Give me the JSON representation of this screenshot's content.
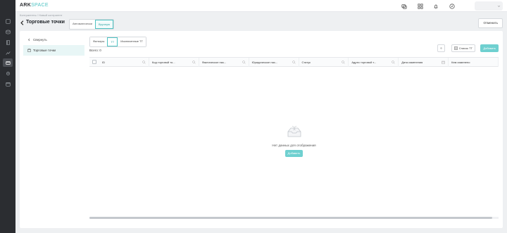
{
  "app": {
    "logo_main": "ARK",
    "logo_accent": "SPACE"
  },
  "header": {
    "breadcrumb": "Контрагенты  /  Новый контрагент",
    "title": "Торговые точки",
    "segments": [
      "Автоматически",
      "Вручную"
    ],
    "segment_selected": 1,
    "cancel_label": "Отменить"
  },
  "sidebar": {
    "items": [
      {
        "label": "Свернуть",
        "icon": "collapse-icon",
        "active": false
      },
      {
        "label": "Торговые точки",
        "icon": "store-icon",
        "active": true
      }
    ]
  },
  "content": {
    "tabs": [
      "Фильтры",
      "ТТ",
      "Исключенные ТТ"
    ],
    "tab_selected": 1,
    "count_label": "Всего: 0",
    "columns_label": "Список ТТ",
    "add_label": "Добавить",
    "columns": [
      "ID",
      "Код торговой то...",
      "Фактическое наз...",
      "Юридическое наз...",
      "Статус",
      "Адрес торговой т...",
      "Дата изменения",
      "Кем изменено"
    ],
    "empty_text": "Нет данных для отображения",
    "empty_add_label": "Добавить"
  },
  "colors": {
    "accent": "#4fc3c3",
    "rail": "#2b2d31"
  }
}
